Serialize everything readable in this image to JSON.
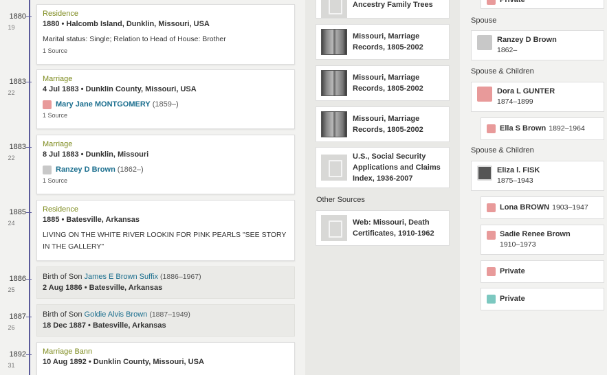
{
  "timeline": [
    {
      "year": "1880",
      "age": "19"
    },
    {
      "year": "1883",
      "age": "22"
    },
    {
      "year": "1883",
      "age": "22"
    },
    {
      "year": "1885",
      "age": "24"
    },
    {
      "year": "1886",
      "age": "25"
    },
    {
      "year": "1887",
      "age": "26"
    },
    {
      "year": "1892",
      "age": "31"
    }
  ],
  "events": {
    "residence_1880": {
      "type": "Residence",
      "date_place": "1880 • Halcomb Island, Dunklin, Missouri, USA",
      "desc": "Marital status: Single; Relation to Head of House: Brother",
      "sources": "1 Source"
    },
    "marriage_1": {
      "type": "Marriage",
      "date_place": "4 Jul 1883 • Dunklin County, Missouri, USA",
      "person": "Mary Jane MONTGOMERY",
      "person_dates": "(1859–)",
      "sources": "1 Source"
    },
    "marriage_2": {
      "type": "Marriage",
      "date_place": "8 Jul 1883 • Dunklin, Missouri",
      "person": "Ranzey D Brown",
      "person_dates": "(1862–)",
      "sources": "1 Source"
    },
    "residence_1885": {
      "type": "Residence",
      "date_place": "1885 • Batesville, Arkansas",
      "desc": "LIVING ON THE WHITE RIVER LOOKIN FOR PINK PEARLS \"SEE STORY IN THE GALLERY\""
    },
    "birth_son_1": {
      "prefix": "Birth of Son",
      "person": "James E Brown Suffix",
      "person_dates": "(1886–1967)",
      "date_place": "2 Aug 1886 • Batesville, Arkansas"
    },
    "birth_son_2": {
      "prefix": "Birth of Son",
      "person": "Goldie Alvis Brown",
      "person_dates": "(1887–1949)",
      "date_place": "18 Dec 1887 • Batesville, Arkansas"
    },
    "marriage_bann": {
      "type": "Marriage Bann",
      "date_place": "10 Aug 1892 • Dunklin County, Missouri, USA"
    }
  },
  "sources": {
    "top_partial": "Ancestry Family Trees",
    "items": [
      {
        "title": "Missouri, Marriage Records, 1805-2002",
        "thumb": "film"
      },
      {
        "title": "Missouri, Marriage Records, 1805-2002",
        "thumb": "film"
      },
      {
        "title": "Missouri, Marriage Records, 1805-2002",
        "thumb": "film"
      },
      {
        "title": "U.S., Social Security Applications and Claims Index, 1936-2007",
        "thumb": "document-icon"
      }
    ],
    "other_label": "Other Sources",
    "other": [
      {
        "title": "Web: Missouri, Death Certificates, 1910-1962",
        "thumb": "document-icon"
      }
    ]
  },
  "family": {
    "top_partial": "Private",
    "spouse_label": "Spouse",
    "spouse": {
      "name": "Ranzey D Brown",
      "dates": "1862–"
    },
    "spouse_children_label_1": "Spouse & Children",
    "spouse_1": {
      "name": "Dora L GUNTER",
      "dates": "1874–1899"
    },
    "children_1": [
      {
        "name": "Ella S Brown",
        "dates": "1892–1964"
      }
    ],
    "spouse_children_label_2": "Spouse & Children",
    "spouse_2": {
      "name": "Eliza l. FISK",
      "dates": "1875–1943"
    },
    "children_2": [
      {
        "name": "Lona BROWN",
        "dates": "1903–1947"
      },
      {
        "name": "Sadie Renee Brown",
        "dates": "1910–1973"
      },
      {
        "name": "Private",
        "dates": ""
      },
      {
        "name": "Private",
        "dates": ""
      }
    ]
  },
  "colors": {
    "event_type": "#7c8a1c",
    "link": "#1a6e8e",
    "timeline": "#5a5a9a"
  }
}
